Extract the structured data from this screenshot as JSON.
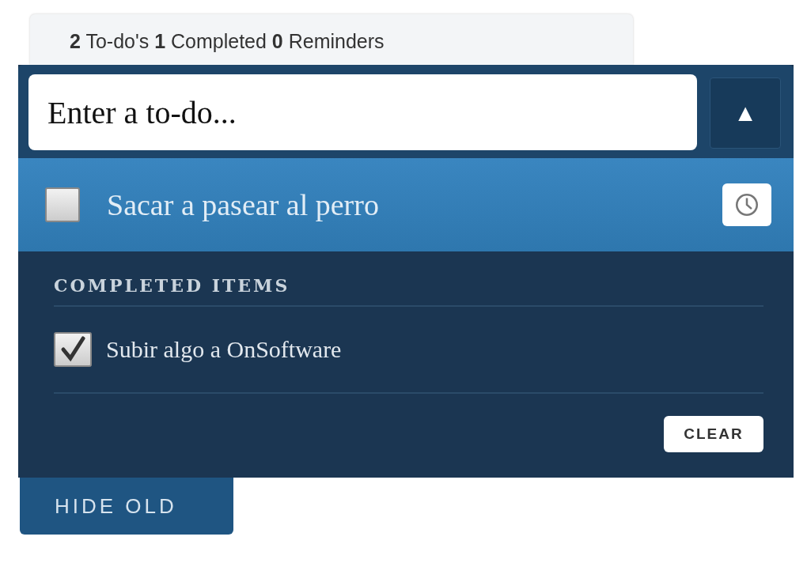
{
  "summary": "**2** To-do's **1** Completed **0** Reminders",
  "input": {
    "placeholder": "Enter a to-do..."
  },
  "collapse_button": "▲",
  "todos": [
    {
      "text": "Sacar a pasear al perro",
      "checked": false
    }
  ],
  "completed": {
    "heading": "COMPLETED ITEMS",
    "items": [
      {
        "text": "Subir algo a OnSoftware",
        "checked": true
      }
    ],
    "clear_button": "CLEAR"
  },
  "hide_old": "HIDE OLD"
}
